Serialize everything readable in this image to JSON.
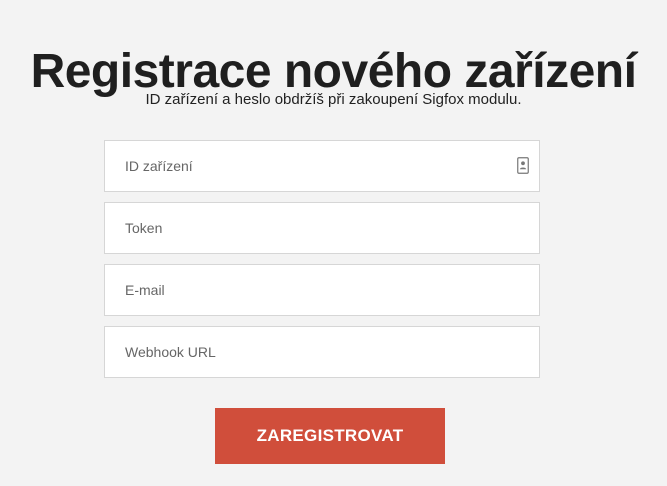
{
  "page": {
    "title": "Registrace nového zařízení",
    "subtitle": "ID zařízení a heslo obdržíš při zakoupení Sigfox modulu."
  },
  "form": {
    "fields": [
      {
        "placeholder": "ID zařízení",
        "value": "",
        "icon": "contact-card-icon"
      },
      {
        "placeholder": "Token",
        "value": ""
      },
      {
        "placeholder": "E-mail",
        "value": ""
      },
      {
        "placeholder": "Webhook URL",
        "value": ""
      }
    ],
    "submit_label": "ZAREGISTROVAT"
  },
  "colors": {
    "background": "#f3f3f3",
    "accent": "#d04e3b",
    "field_border": "#d6d6d6"
  }
}
